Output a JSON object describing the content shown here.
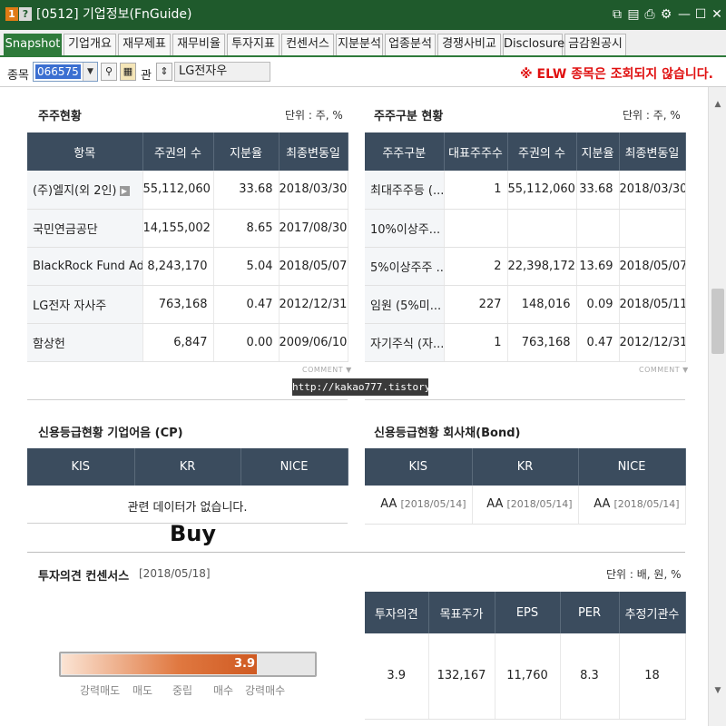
{
  "window": {
    "badge_num": "1",
    "badge_q": "?",
    "title": "[0512] 기업정보(FnGuide)",
    "buttons": [
      "⧉",
      "▤",
      "⎙",
      "⚙",
      "—",
      "☐",
      "✕"
    ]
  },
  "tabs": [
    "Snapshot",
    "기업개요",
    "재무제표",
    "재무비율",
    "투자지표",
    "컨센서스",
    "지분분석",
    "업종분석",
    "경쟁사비교",
    "Disclosure",
    "금감원공시"
  ],
  "stockbar": {
    "label": "종목",
    "code": "066575",
    "gwan_label": "관",
    "stock_name": "LG전자우",
    "notice": "※ ELW 종목은 조회되지 않습니다."
  },
  "shareholders": {
    "title": "주주현황",
    "unit": "단위 : 주, %",
    "headers": [
      "항목",
      "주권의 수",
      "지분율",
      "최종변동일"
    ],
    "rows": [
      [
        "(주)엘지(외 2인)",
        "55,112,060",
        "33.68",
        "2018/03/30"
      ],
      [
        "국민연금공단",
        "14,155,002",
        "8.65",
        "2017/08/30"
      ],
      [
        "BlackRock Fund Advisors",
        "8,243,170",
        "5.04",
        "2018/05/07"
      ],
      [
        "LG전자 자사주",
        "763,168",
        "0.47",
        "2012/12/31"
      ],
      [
        "함상헌",
        "6,847",
        "0.00",
        "2009/06/10"
      ]
    ],
    "comment": "COMMENT ▼"
  },
  "shareholder_types": {
    "title": "주주구분 현황",
    "unit": "단위 : 주, %",
    "headers": [
      "주주구분",
      "대표주주수",
      "주권의 수",
      "지분율",
      "최종변동일"
    ],
    "rows": [
      [
        "최대주주등 (...",
        "1",
        "55,112,060",
        "33.68",
        "2018/03/30"
      ],
      [
        "10%이상주...",
        "",
        "",
        "",
        ""
      ],
      [
        "5%이상주주 ...",
        "2",
        "22,398,172",
        "13.69",
        "2018/05/07"
      ],
      [
        "임원 (5%미...",
        "227",
        "148,016",
        "0.09",
        "2018/05/11"
      ],
      [
        "자기주식 (자...",
        "1",
        "763,168",
        "0.47",
        "2012/12/31"
      ]
    ],
    "comment": "COMMENT ▼"
  },
  "watermark": "http://kakao777.tistory.com",
  "credit_cp": {
    "title": "신용등급현황 기업어음 (CP)",
    "headers": [
      "KIS",
      "KR",
      "NICE"
    ],
    "nodata": "관련 데이터가 없습니다."
  },
  "credit_bond": {
    "title": "신용등급현황 회사채(Bond)",
    "headers": [
      "KIS",
      "KR",
      "NICE"
    ],
    "cells": [
      {
        "grade": "AA",
        "date": "[2018/05/14]"
      },
      {
        "grade": "AA",
        "date": "[2018/05/14]"
      },
      {
        "grade": "AA",
        "date": "[2018/05/14]"
      }
    ]
  },
  "consensus": {
    "title": "투자의견 컨센서스",
    "date": "[2018/05/18]",
    "unit": "단위 : 배, 원, %",
    "opinion": "Buy",
    "score": "3.9",
    "score_ratio": 0.78,
    "scale": [
      "강력매도",
      "매도",
      "중립",
      "매수",
      "강력매수"
    ],
    "headers": [
      "투자의견",
      "목표주가",
      "EPS",
      "PER",
      "추정기관수"
    ],
    "values": [
      "3.9",
      "132,167",
      "11,760",
      "8.3",
      "18"
    ]
  }
}
